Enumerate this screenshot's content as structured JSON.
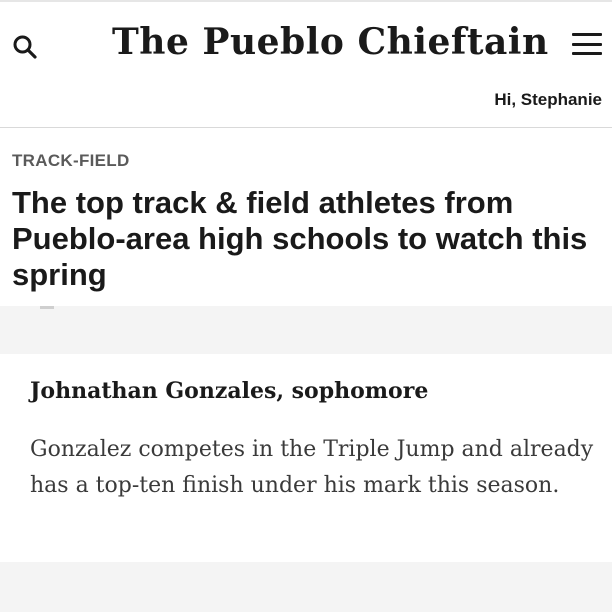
{
  "header": {
    "masthead": "The Pueblo Chieftain",
    "greeting": "Hi, Stephanie",
    "search_icon": "search-icon",
    "menu_icon": "hamburger-menu-icon"
  },
  "article": {
    "section": "TRACK-FIELD",
    "headline": "The top track & field athletes from Pueblo-area high schools to watch this spring"
  },
  "card": {
    "title": "Johnathan Gonzales, sophomore",
    "body": "Gonzalez competes in the Triple Jump and already has a top-ten finish under his mark this season."
  }
}
